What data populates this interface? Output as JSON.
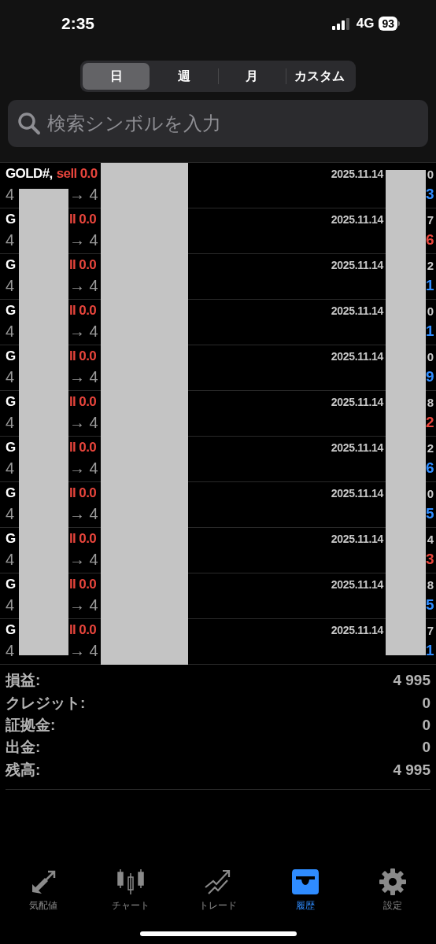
{
  "status_bar": {
    "time": "2:35",
    "network": "4G",
    "battery": "93"
  },
  "period_tabs": [
    {
      "label": "日",
      "selected": true
    },
    {
      "label": "週",
      "selected": false
    },
    {
      "label": "月",
      "selected": false
    },
    {
      "label": "カスタム",
      "selected": false
    }
  ],
  "search": {
    "placeholder": "検索シンボルを入力"
  },
  "redacted": true,
  "trades": [
    {
      "symbol": "GOLD#,",
      "side": "sell 0.0",
      "price_open": "4",
      "price_close": "→ 4",
      "date": "2025.11.14",
      "time_tail": "0",
      "profit_tail": "3",
      "color": "#2f8cff"
    },
    {
      "symbol": "G",
      "side": "ll 0.0",
      "price_open": "4",
      "price_close": "→ 4",
      "date": "2025.11.14",
      "time_tail": "7",
      "profit_tail": "6",
      "color": "#e8453c"
    },
    {
      "symbol": "G",
      "side": "ll 0.0",
      "price_open": "4",
      "price_close": "→ 4",
      "date": "2025.11.14",
      "time_tail": "2",
      "profit_tail": "1",
      "color": "#2f8cff"
    },
    {
      "symbol": "G",
      "side": "ll 0.0",
      "price_open": "4",
      "price_close": "→ 4",
      "date": "2025.11.14",
      "time_tail": "0",
      "profit_tail": "1",
      "color": "#2f8cff"
    },
    {
      "symbol": "G",
      "side": "ll 0.0",
      "price_open": "4",
      "price_close": "→ 4",
      "date": "2025.11.14",
      "time_tail": "0",
      "profit_tail": "9",
      "color": "#2f8cff"
    },
    {
      "symbol": "G",
      "side": "ll 0.0",
      "price_open": "4",
      "price_close": "→ 4",
      "date": "2025.11.14",
      "time_tail": "8",
      "profit_tail": "2",
      "color": "#e8453c"
    },
    {
      "symbol": "G",
      "side": "ll 0.0",
      "price_open": "4",
      "price_close": "→ 4",
      "date": "2025.11.14",
      "time_tail": "2",
      "profit_tail": "6",
      "color": "#2f8cff"
    },
    {
      "symbol": "G",
      "side": "ll 0.0",
      "price_open": "4",
      "price_close": "→ 4",
      "date": "2025.11.14",
      "time_tail": "0",
      "profit_tail": "5",
      "color": "#2f8cff"
    },
    {
      "symbol": "G",
      "side": "ll 0.0",
      "price_open": "4",
      "price_close": "→ 4",
      "date": "2025.11.14",
      "time_tail": "4",
      "profit_tail": "3",
      "color": "#e8453c"
    },
    {
      "symbol": "G",
      "side": "ll 0.0",
      "price_open": "4",
      "price_close": "→ 4",
      "date": "2025.11.14",
      "time_tail": "8",
      "profit_tail": "5",
      "color": "#2f8cff"
    },
    {
      "symbol": "G",
      "side": "ll 0.0",
      "price_open": "4",
      "price_close": "→ 4",
      "date": "2025.11.14",
      "time_tail": "7",
      "profit_tail": "1",
      "color": "#2f8cff"
    }
  ],
  "summary": [
    {
      "label": "損益:",
      "value": "4 995"
    },
    {
      "label": "クレジット:",
      "value": "0"
    },
    {
      "label": "証拠金:",
      "value": "0"
    },
    {
      "label": "出金:",
      "value": "0"
    },
    {
      "label": "残高:",
      "value": "4 995"
    }
  ],
  "tab_bar": [
    {
      "label": "気配値",
      "selected": false
    },
    {
      "label": "チャート",
      "selected": false
    },
    {
      "label": "トレード",
      "selected": false
    },
    {
      "label": "履歴",
      "selected": true
    },
    {
      "label": "設定",
      "selected": false
    }
  ]
}
